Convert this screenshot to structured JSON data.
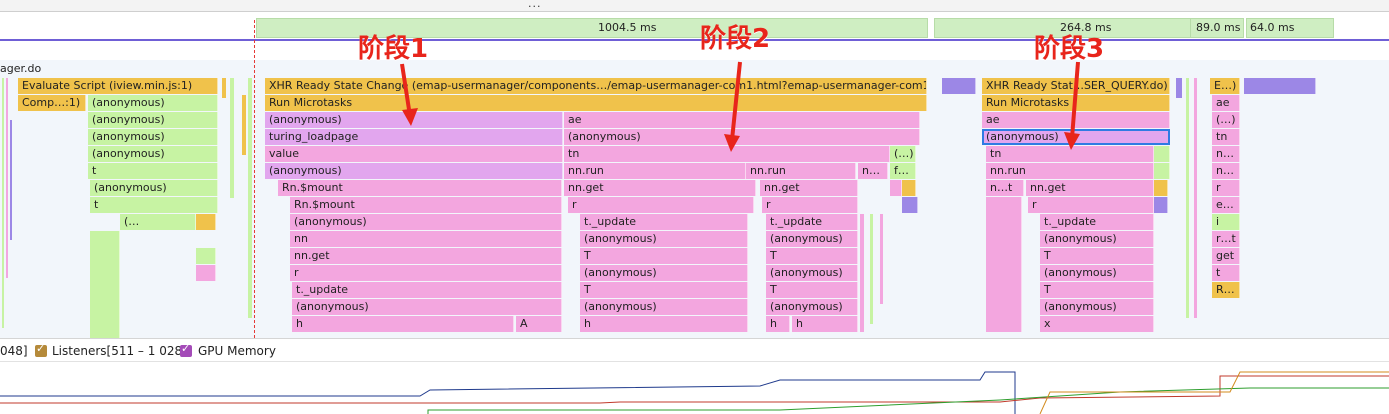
{
  "top_ellipsis": "...",
  "network": {
    "timing_1": "1004.5 ms",
    "timing_2": "264.8 ms",
    "timing_3": "89.0 ms",
    "timing_4": "64.0 ms"
  },
  "main_label": "ager.do",
  "stages": {
    "stage1": "阶段1",
    "stage2": "阶段2",
    "stage3": "阶段3"
  },
  "flame": {
    "left": {
      "evaluate_script": "Evaluate Script (iview.min.js:1)",
      "comp": "Comp…:1)",
      "anon1": "(anonymous)",
      "anon2": "(anonymous)",
      "anon3": "(anonymous)",
      "anon4": "(anonymous)",
      "t1": "t",
      "anon5": "(anonymous)",
      "t2": "t",
      "paren": "(…"
    },
    "mid": {
      "xhr": "XHR Ready State Change (emap-usermanager/components…/emap-usermanager-com1.html?emap-usermanager-com1)",
      "run_microtasks": "Run Microtasks",
      "anon": "(anonymous)",
      "turing": "turing_loadpage",
      "value": "value",
      "anon2": "(anonymous)",
      "rn_mount1": "Rn.$mount",
      "rn_mount2": "Rn.$mount",
      "anon3": "(anonymous)",
      "nn": "nn",
      "nn_get": "nn.get",
      "r": "r",
      "t_update": "t._update",
      "anon4": "(anonymous)",
      "h": "h",
      "a": "A",
      "ae": "ae",
      "anon_b": "(anonymous)",
      "tn": "tn",
      "nn_run": "nn.run",
      "nn_get_b": "nn.get",
      "r_b": "r",
      "t_update_b": "t._update",
      "anon_c": "(anonymous)",
      "T1": "T",
      "anon_d": "(anonymous)",
      "T2": "T",
      "anon_e": "(anonymous)",
      "h_b": "h",
      "nn_run_c": "nn.run",
      "nn_ellipsis": "n…",
      "nn_get_c": "nn.get",
      "r_c": "r",
      "t_update_c": "t._update",
      "anon_f": "(anonymous)",
      "T3": "T",
      "anon_g": "(anonymous)",
      "T4": "T",
      "anon_h": "(anonymous)",
      "h_c1": "h",
      "h_c2": "h",
      "paren_small": "(…)",
      "f_small": "f…"
    },
    "right": {
      "xhr": "XHR Ready Stat…SER_QUERY.do)",
      "run_microtasks": "Run Microtasks",
      "ae": "ae",
      "anon_sel": "(anonymous)",
      "tn": "tn",
      "nn_run": "nn.run",
      "nt": "n…t",
      "nn_get": "nn.get",
      "r": "r",
      "t_update": "t._update",
      "anon1": "(anonymous)",
      "T1": "T",
      "anon2": "(anonymous)",
      "T2": "T",
      "anon3": "(anonymous)",
      "x": "x"
    },
    "far_right": {
      "e": "E…)",
      "ae": "ae",
      "paren": "(…)",
      "tn": "tn",
      "n1": "n…",
      "n2": "n…",
      "r": "r",
      "e2": "e…",
      "i": "i",
      "rt": "r…t",
      "get": "get",
      "t": "t",
      "R": "R…"
    }
  },
  "legend": {
    "prefix": "048]",
    "listeners": "Listeners[511 – 1 028]",
    "gpu": "GPU Memory"
  },
  "colors": {
    "yellow": "#f0c24b",
    "green": "#c7f3a3",
    "pink": "#f3a6df",
    "purple": "#9c87e6",
    "stage_red": "#e8251b",
    "selection_blue": "#2f7be3"
  }
}
